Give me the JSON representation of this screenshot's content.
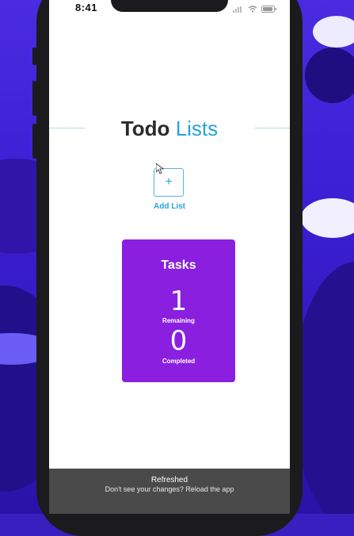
{
  "status_bar": {
    "time": "8:41"
  },
  "header": {
    "title_bold": "Todo",
    "title_light": "Lists"
  },
  "add_list": {
    "icon": "+",
    "label": "Add List"
  },
  "lists": [
    {
      "name": "Tasks",
      "remaining": "1",
      "remaining_label": "Remaining",
      "completed": "0",
      "completed_label": "Completed",
      "color": "#8a1fe0"
    }
  ],
  "toast": {
    "title": "Refreshed",
    "message": "Don't see your changes? Reload the app"
  },
  "colors": {
    "accent": "#26a3dd",
    "card": "#8a1fe0"
  }
}
